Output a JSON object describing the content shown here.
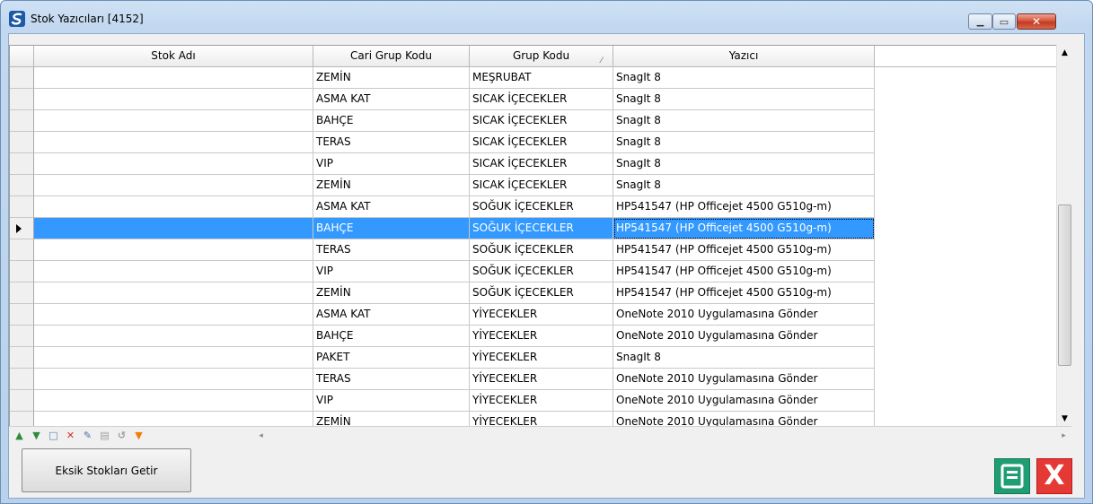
{
  "window": {
    "title": "Stok Yazıcıları [4152]",
    "min_glyph": "▁",
    "max_glyph": "▭",
    "close_glyph": "✕"
  },
  "grid": {
    "columns": [
      "Stok Adı",
      "Cari Grup Kodu",
      "Grup Kodu",
      "Yazıcı"
    ],
    "sort_glyph": "⁄",
    "selected_row_index": 7,
    "rows": [
      {
        "stok_adi": "",
        "cari_grup": "ZEMİN",
        "grup": "MEŞRUBAT",
        "yazici": "SnagIt 8"
      },
      {
        "stok_adi": "",
        "cari_grup": "ASMA KAT",
        "grup": "SICAK İÇECEKLER",
        "yazici": "SnagIt 8"
      },
      {
        "stok_adi": "",
        "cari_grup": "BAHÇE",
        "grup": "SICAK İÇECEKLER",
        "yazici": "SnagIt 8"
      },
      {
        "stok_adi": "",
        "cari_grup": "TERAS",
        "grup": "SICAK İÇECEKLER",
        "yazici": "SnagIt 8"
      },
      {
        "stok_adi": "",
        "cari_grup": "VIP",
        "grup": "SICAK İÇECEKLER",
        "yazici": "SnagIt 8"
      },
      {
        "stok_adi": "",
        "cari_grup": "ZEMİN",
        "grup": "SICAK İÇECEKLER",
        "yazici": "SnagIt 8"
      },
      {
        "stok_adi": "",
        "cari_grup": "ASMA KAT",
        "grup": "SOĞUK İÇECEKLER",
        "yazici": "HP541547 (HP Officejet 4500 G510g-m)"
      },
      {
        "stok_adi": "",
        "cari_grup": "BAHÇE",
        "grup": "SOĞUK İÇECEKLER",
        "yazici": "HP541547 (HP Officejet 4500 G510g-m)"
      },
      {
        "stok_adi": "",
        "cari_grup": "TERAS",
        "grup": "SOĞUK İÇECEKLER",
        "yazici": "HP541547 (HP Officejet 4500 G510g-m)"
      },
      {
        "stok_adi": "",
        "cari_grup": "VIP",
        "grup": "SOĞUK İÇECEKLER",
        "yazici": "HP541547 (HP Officejet 4500 G510g-m)"
      },
      {
        "stok_adi": "",
        "cari_grup": "ZEMİN",
        "grup": "SOĞUK İÇECEKLER",
        "yazici": "HP541547 (HP Officejet 4500 G510g-m)"
      },
      {
        "stok_adi": "",
        "cari_grup": "ASMA KAT",
        "grup": "YİYECEKLER",
        "yazici": "OneNote 2010 Uygulamasına Gönder"
      },
      {
        "stok_adi": "",
        "cari_grup": "BAHÇE",
        "grup": "YİYECEKLER",
        "yazici": "OneNote 2010 Uygulamasına Gönder"
      },
      {
        "stok_adi": "",
        "cari_grup": "PAKET",
        "grup": "YİYECEKLER",
        "yazici": "SnagIt 8"
      },
      {
        "stok_adi": "",
        "cari_grup": "TERAS",
        "grup": "YİYECEKLER",
        "yazici": "OneNote 2010 Uygulamasına Gönder"
      },
      {
        "stok_adi": "",
        "cari_grup": "VIP",
        "grup": "YİYECEKLER",
        "yazici": "OneNote 2010 Uygulamasına Gönder"
      },
      {
        "stok_adi": "",
        "cari_grup": "ZEMİN",
        "grup": "YİYECEKLER",
        "yazici": "OneNote 2010 Uygulamasına Gönder"
      }
    ]
  },
  "scrollbars": {
    "up": "▲",
    "down": "▼",
    "left": "◂",
    "right": "▸"
  },
  "navigator": {
    "buttons": [
      {
        "name": "nav-prior-button",
        "glyph": "▲",
        "color": "#2e8b3a"
      },
      {
        "name": "nav-next-button",
        "glyph": "▼",
        "color": "#2e8b3a"
      },
      {
        "name": "nav-insert-button",
        "glyph": "□",
        "color": "#5a7fb5"
      },
      {
        "name": "nav-delete-button",
        "glyph": "✕",
        "color": "#d32f2f"
      },
      {
        "name": "nav-edit-button",
        "glyph": "✎",
        "color": "#4a6fa5"
      },
      {
        "name": "nav-post-button",
        "glyph": "▤",
        "color": "#9e9e9e"
      },
      {
        "name": "nav-cancel-button",
        "glyph": "↺",
        "color": "#9e9e9e"
      },
      {
        "name": "nav-filter-button",
        "glyph": "▼",
        "color": "#f57c00"
      }
    ]
  },
  "actions": {
    "eksik_label": "Eksik Stokları Getir",
    "cancel_glyph": "X"
  },
  "colors": {
    "selection": "#3399ff",
    "save": "#1f9e73",
    "cancel": "#e53935"
  }
}
